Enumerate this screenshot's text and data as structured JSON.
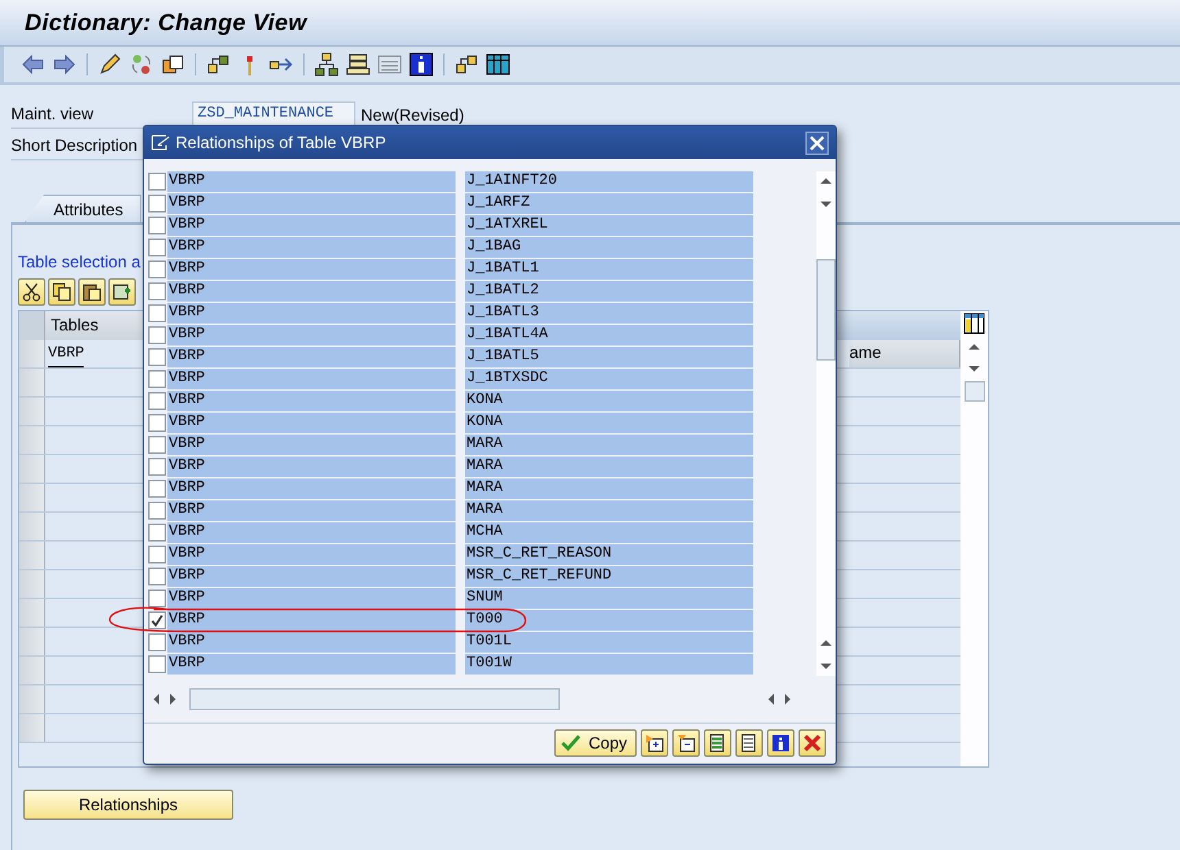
{
  "window": {
    "title": "Dictionary: Change View"
  },
  "fields": [
    {
      "label": "Maint. view",
      "value": "ZSD_MAINTENANCE",
      "note": "New(Revised)"
    },
    {
      "label": "Short Description"
    }
  ],
  "tabs": [
    {
      "label": "Attributes",
      "selected": true
    }
  ],
  "panel": {
    "heading": "Table selection a",
    "table": {
      "columns": [
        "Tables",
        "ame"
      ],
      "rows": [
        "VBRP"
      ]
    },
    "button": "Relationships"
  },
  "dialog": {
    "title": "Relationships of Table VBRP",
    "copy_button": "Copy",
    "rows": [
      {
        "column_1": "VBRP",
        "column_2": "J_1AINFT20",
        "checked": false
      },
      {
        "column_1": "VBRP",
        "column_2": "J_1ARFZ",
        "checked": false
      },
      {
        "column_1": "VBRP",
        "column_2": "J_1ATXREL",
        "checked": false
      },
      {
        "column_1": "VBRP",
        "column_2": "J_1BAG",
        "checked": false
      },
      {
        "column_1": "VBRP",
        "column_2": "J_1BATL1",
        "checked": false
      },
      {
        "column_1": "VBRP",
        "column_2": "J_1BATL2",
        "checked": false
      },
      {
        "column_1": "VBRP",
        "column_2": "J_1BATL3",
        "checked": false
      },
      {
        "column_1": "VBRP",
        "column_2": "J_1BATL4A",
        "checked": false
      },
      {
        "column_1": "VBRP",
        "column_2": "J_1BATL5",
        "checked": false
      },
      {
        "column_1": "VBRP",
        "column_2": "J_1BTXSDC",
        "checked": false
      },
      {
        "column_1": "VBRP",
        "column_2": "KONA",
        "checked": false
      },
      {
        "column_1": "VBRP",
        "column_2": "KONA",
        "checked": false
      },
      {
        "column_1": "VBRP",
        "column_2": "MARA",
        "checked": false
      },
      {
        "column_1": "VBRP",
        "column_2": "MARA",
        "checked": false
      },
      {
        "column_1": "VBRP",
        "column_2": "MARA",
        "checked": false
      },
      {
        "column_1": "VBRP",
        "column_2": "MARA",
        "checked": false
      },
      {
        "column_1": "VBRP",
        "column_2": "MCHA",
        "checked": false
      },
      {
        "column_1": "VBRP",
        "column_2": "MSR_C_RET_REASON",
        "checked": false
      },
      {
        "column_1": "VBRP",
        "column_2": "MSR_C_RET_REFUND",
        "checked": false
      },
      {
        "column_1": "VBRP",
        "column_2": "SNUM",
        "checked": false
      },
      {
        "column_1": "VBRP",
        "column_2": "T000",
        "checked": true
      },
      {
        "column_1": "VBRP",
        "column_2": "T001L",
        "checked": false
      },
      {
        "column_1": "VBRP",
        "column_2": "T001W",
        "checked": false
      }
    ]
  }
}
